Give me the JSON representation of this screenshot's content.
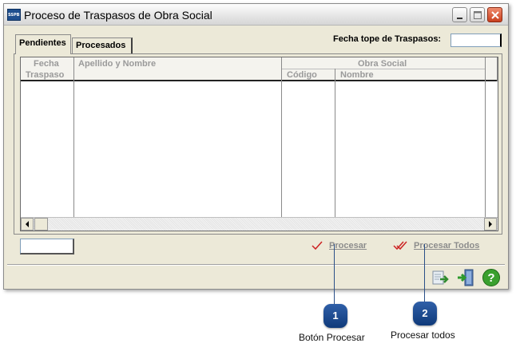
{
  "window": {
    "app_icon_text": "SSPBN",
    "title": "Proceso de Traspasos de Obra Social"
  },
  "tabs": [
    {
      "label": "Pendientes",
      "active": true
    },
    {
      "label": "Procesados",
      "active": false
    }
  ],
  "fecha_tope": {
    "label": "Fecha tope de Traspasos:",
    "value": ""
  },
  "grid": {
    "headers": {
      "fecha_line1": "Fecha",
      "fecha_line2": "Traspaso",
      "apellido": "Apellido y Nombre",
      "obra_social": "Obra Social",
      "codigo": "Código",
      "nombre": "Nombre"
    },
    "rows": []
  },
  "count_box": {
    "value": ""
  },
  "actions": {
    "procesar": "Procesar",
    "procesar_todos": "Procesar Todos",
    "enabled": false,
    "disabled_color": "#8c8c8c",
    "check_color": "#cc2222"
  },
  "footer_icons": [
    "export-icon",
    "exit-door-icon",
    "help-icon"
  ],
  "callouts": [
    {
      "number": "1",
      "caption": "Botón Procesar"
    },
    {
      "number": "2",
      "caption": "Procesar todos"
    }
  ],
  "colors": {
    "window_bg": "#ece9d8",
    "badge": "#1f4f8f",
    "help_green": "#3aa02e"
  }
}
